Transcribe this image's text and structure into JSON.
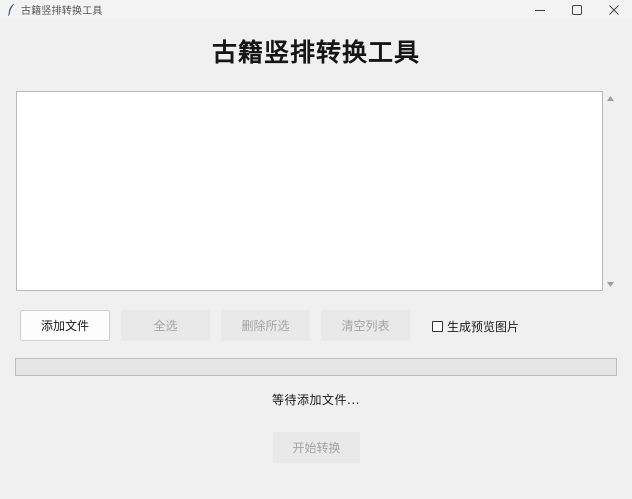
{
  "window": {
    "title": "古籍竖排转换工具",
    "app_icon": "feather-quill-icon",
    "controls": [
      "minimize-icon",
      "maximize-icon",
      "close-icon"
    ]
  },
  "header": {
    "title": "古籍竖排转换工具"
  },
  "file_list": {
    "items": []
  },
  "buttons": {
    "add_files": "添加文件",
    "select_all": "全选",
    "delete_selected": "删除所选",
    "clear_list": "清空列表",
    "start": "开始转换"
  },
  "options": {
    "preview_label": "生成预览图片",
    "preview_checked": false
  },
  "progress": {
    "value": 0
  },
  "status": {
    "text": "等待添加文件..."
  }
}
